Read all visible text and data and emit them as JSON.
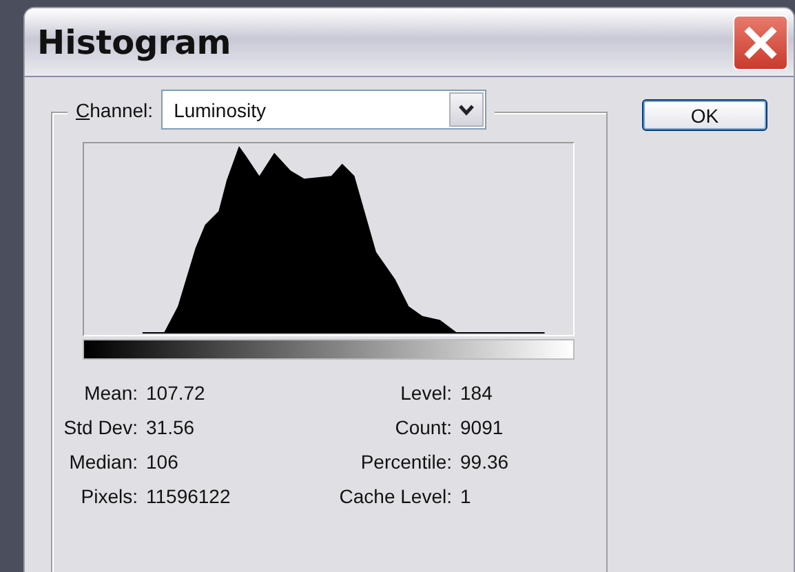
{
  "window": {
    "title": "Histogram"
  },
  "channel": {
    "label": "Channel:",
    "value": "Luminosity"
  },
  "ok_button": "OK",
  "stats_left": [
    {
      "label": "Mean:",
      "value": "107.72"
    },
    {
      "label": "Std Dev:",
      "value": "31.56"
    },
    {
      "label": "Median:",
      "value": "106"
    },
    {
      "label": "Pixels:",
      "value": "11596122"
    }
  ],
  "stats_right": [
    {
      "label": "Level:",
      "value": "184"
    },
    {
      "label": "Count:",
      "value": "9091"
    },
    {
      "label": "Percentile:",
      "value": "99.36"
    },
    {
      "label": "Cache Level:",
      "value": "1"
    }
  ]
}
